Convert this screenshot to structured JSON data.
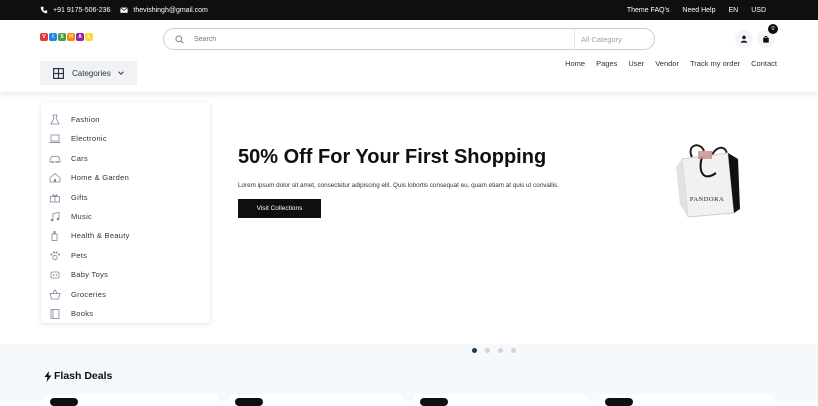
{
  "topbar": {
    "phone": "+91 9175-506-236",
    "email": "thevishingh@gmail.com",
    "links": [
      "Theme FAQ's",
      "Need Help",
      "EN",
      "USD"
    ]
  },
  "header": {
    "logo_letters": [
      "V",
      "I",
      "S",
      "H",
      "A",
      "L"
    ],
    "logo_colors": [
      "#e53935",
      "#1e88e5",
      "#43a047",
      "#fb8c00",
      "#8e24aa",
      "#fdd835"
    ],
    "search_placeholder": "Search",
    "search_category": "All Category",
    "cart_count": "0",
    "categories_label": "Categories",
    "nav": [
      "Home",
      "Pages",
      "User",
      "Vendor",
      "Track my order",
      "Contact"
    ]
  },
  "categories": [
    {
      "label": "Fashion",
      "icon": "dress-icon"
    },
    {
      "label": "Electronic",
      "icon": "laptop-icon"
    },
    {
      "label": "Cars",
      "icon": "car-icon"
    },
    {
      "label": "Home & Garden",
      "icon": "house-icon"
    },
    {
      "label": "Gifts",
      "icon": "gift-icon"
    },
    {
      "label": "Music",
      "icon": "music-icon"
    },
    {
      "label": "Health & Beauty",
      "icon": "lotion-icon"
    },
    {
      "label": "Pets",
      "icon": "paw-icon"
    },
    {
      "label": "Baby Toys",
      "icon": "toy-icon"
    },
    {
      "label": "Groceries",
      "icon": "basket-icon"
    },
    {
      "label": "Books",
      "icon": "book-icon"
    }
  ],
  "hero": {
    "title": "50% Off For Your First Shopping",
    "text": "Lorem ipsum dolor sit amet, consectetur adipiscing elit. Quis lobortis consequat eu, quam etiam at quis ut convallis.",
    "button": "Visit Collections",
    "bag_brand": "PANDORA",
    "carousel_active": 1,
    "carousel_count": 4
  },
  "flash": {
    "title": "Flash Deals"
  },
  "colors": {
    "dark": "#0f0f0f",
    "text": "#2b3445",
    "muted": "#7d879c",
    "section_bg": "#f6f9fc"
  }
}
